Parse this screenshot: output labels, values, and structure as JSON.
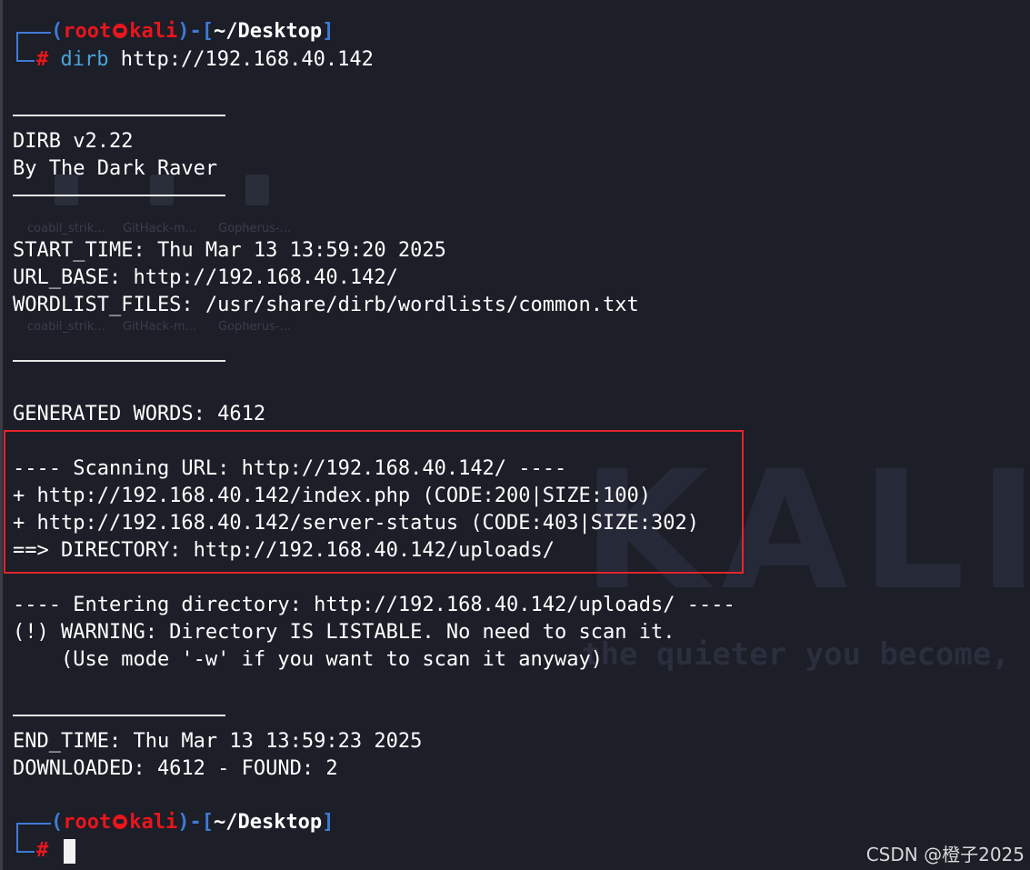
{
  "prompt": {
    "open": "(",
    "user": "root",
    "host": "kali",
    "close_user": ")-[",
    "path": "~/Desktop",
    "close_path": "]",
    "hash": "#"
  },
  "command": {
    "tool": "dirb",
    "arg": " http://192.168.40.142"
  },
  "output": {
    "version": "DIRB v2.22",
    "author": "By The Dark Raver",
    "start_time": "START_TIME: Thu Mar 13 13:59:20 2025",
    "url_base": "URL_BASE: http://192.168.40.142/",
    "wordlist": "WORDLIST_FILES: /usr/share/dirb/wordlists/common.txt",
    "generated": "GENERATED WORDS: 4612",
    "scanning": "---- Scanning URL: http://192.168.40.142/ ----",
    "hit1": "+ http://192.168.40.142/index.php (CODE:200|SIZE:100)",
    "hit2": "+ http://192.168.40.142/server-status (CODE:403|SIZE:302)",
    "dir": "==> DIRECTORY: http://192.168.40.142/uploads/",
    "entering": "---- Entering directory: http://192.168.40.142/uploads/ ----",
    "warning": "(!) WARNING: Directory IS LISTABLE. No need to scan it.",
    "hint": "    (Use mode '-w' if you want to scan it anyway)",
    "end_time": "END_TIME: Thu Mar 13 13:59:23 2025",
    "downloaded": "DOWNLOADED: 4612 - FOUND: 2"
  },
  "background": {
    "brand": "KALI",
    "tagline": "the quieter you become,",
    "icons": [
      "coabil_strik...",
      "GitHack-m...",
      "Gopherus-...",
      "coabil_strik...",
      "GitHack-m...",
      "Gopherus-..."
    ]
  },
  "watermark": "CSDN @橙子2025",
  "colors": {
    "background": "#1c1e28",
    "prompt_frame": "#3e7bd6",
    "user_host": "#e8161c",
    "command": "#4aa3d8",
    "highlight_border": "#e3242b"
  }
}
